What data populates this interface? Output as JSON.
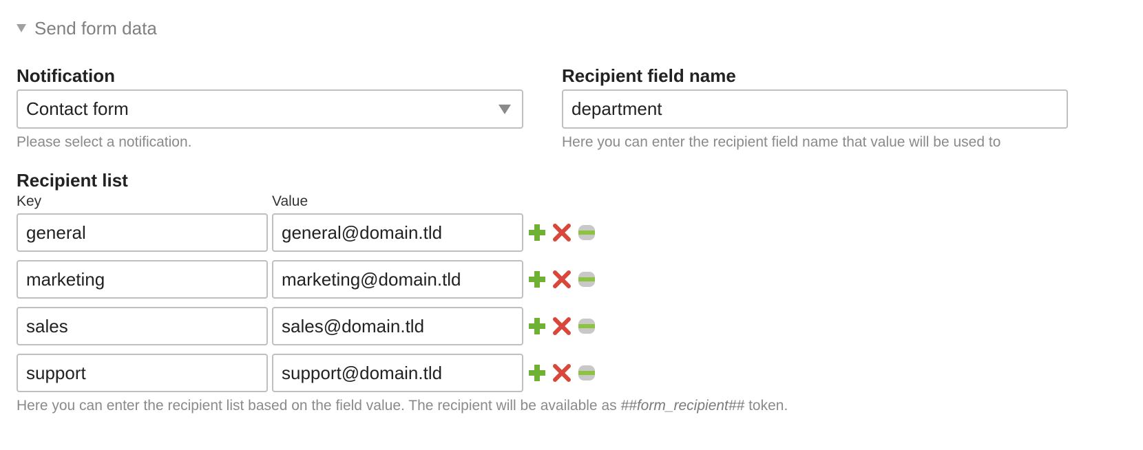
{
  "section": {
    "legend": "Send form data"
  },
  "notification": {
    "label": "Notification",
    "selected": "Contact form",
    "help": "Please select a notification."
  },
  "recipient_field": {
    "label": "Recipient field name",
    "value": "department",
    "help": "Here you can enter the recipient field name that value will be used to"
  },
  "recipient_list": {
    "label": "Recipient list",
    "key_header": "Key",
    "value_header": "Value",
    "rows": [
      {
        "key": "general",
        "value": "general@domain.tld"
      },
      {
        "key": "marketing",
        "value": "marketing@domain.tld"
      },
      {
        "key": "sales",
        "value": "sales@domain.tld"
      },
      {
        "key": "support",
        "value": "support@domain.tld"
      }
    ],
    "help_prefix": "Here you can enter the recipient list based on the field value. The recipient will be available as ",
    "help_token": "##form_recipient##",
    "help_suffix": " token."
  },
  "icons": {
    "add": "plus-icon",
    "delete": "x-icon",
    "drag": "drag-handle-icon"
  },
  "colors": {
    "add": "#6fb134",
    "delete": "#d9463a",
    "drag_bg": "#c8c8c8",
    "drag_bar": "#8cc43f"
  }
}
